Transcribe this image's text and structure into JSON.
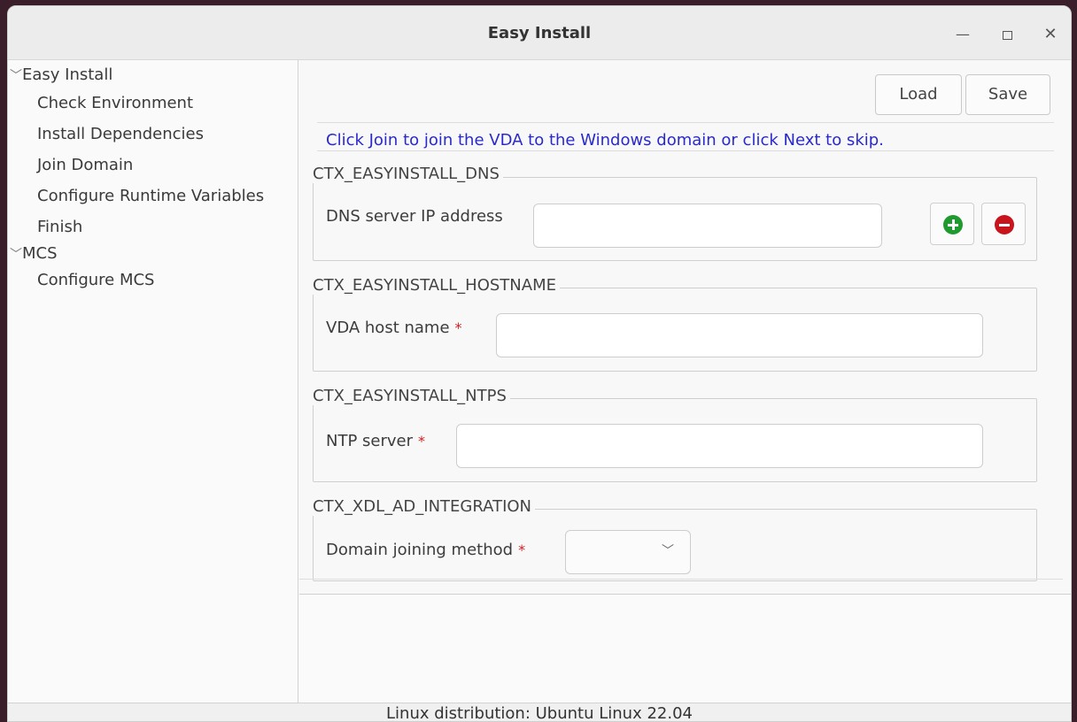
{
  "window": {
    "title": "Easy Install",
    "min_glyph": "—",
    "close_glyph": "✕"
  },
  "sidebar": {
    "groups": [
      {
        "label": "Easy Install",
        "items": [
          "Check Environment",
          "Install Dependencies",
          "Join Domain",
          "Configure Runtime Variables",
          "Finish"
        ]
      },
      {
        "label": "MCS",
        "items": [
          "Configure MCS"
        ]
      }
    ],
    "chevron_glyph": "﹀"
  },
  "toolbar": {
    "load_label": "Load",
    "save_label": "Save"
  },
  "notice": "Click Join to join the VDA to the Windows domain or click Next to skip.",
  "sections": {
    "dns": {
      "title": "CTX_EASYINSTALL_DNS",
      "field_label": "DNS server IP address",
      "value": ""
    },
    "hostname": {
      "title": "CTX_EASYINSTALL_HOSTNAME",
      "field_label": "VDA host name",
      "value": ""
    },
    "ntps": {
      "title": "CTX_EASYINSTALL_NTPS",
      "field_label": "NTP server",
      "value": ""
    },
    "ad": {
      "title": "CTX_XDL_AD_INTEGRATION",
      "field_label": "Domain joining method",
      "selected": ""
    }
  },
  "required_marker": "*",
  "status": "Linux distribution: Ubuntu Linux 22.04",
  "colors": {
    "notice": "#2a2acc",
    "required": "#d02020",
    "add": "#1f9a2e",
    "remove": "#c8141c"
  }
}
